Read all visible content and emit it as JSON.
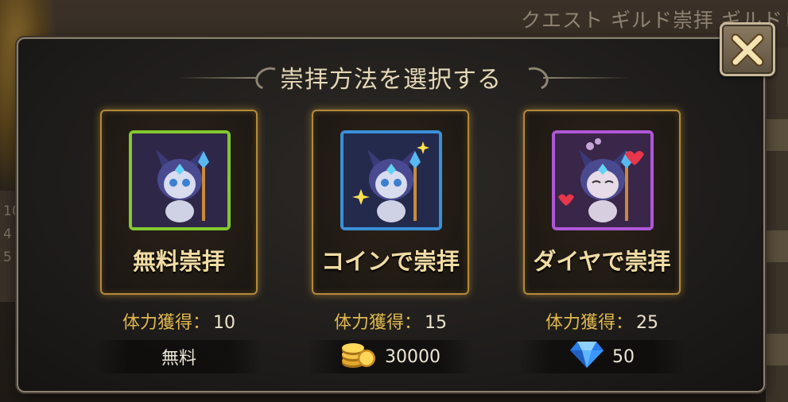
{
  "background": {
    "header_text": "クエスト ギルド崇拝 ギルドレ",
    "side_list": [
      "10",
      "4",
      "5"
    ]
  },
  "modal": {
    "title": "崇拝方法を選択する"
  },
  "options": [
    {
      "id": "free",
      "label": "無料崇拝",
      "stamina_label": "体力獲得：",
      "stamina_value": "10",
      "cost_text": "無料",
      "frame_color": "#82c92f"
    },
    {
      "id": "coin",
      "label": "コインで崇拝",
      "stamina_label": "体力獲得：",
      "stamina_value": "15",
      "cost_icon": "gold-coins-icon",
      "cost_text": "30000",
      "frame_color": "#3b8fd8"
    },
    {
      "id": "diamond",
      "label": "ダイヤで崇拝",
      "stamina_label": "体力獲得：",
      "stamina_value": "25",
      "cost_icon": "diamond-icon",
      "cost_text": "50",
      "frame_color": "#b057d8"
    }
  ],
  "colors": {
    "gold_text": "#e0b84e",
    "label_text": "#f1dca3",
    "card_border": "#b48a3a"
  }
}
